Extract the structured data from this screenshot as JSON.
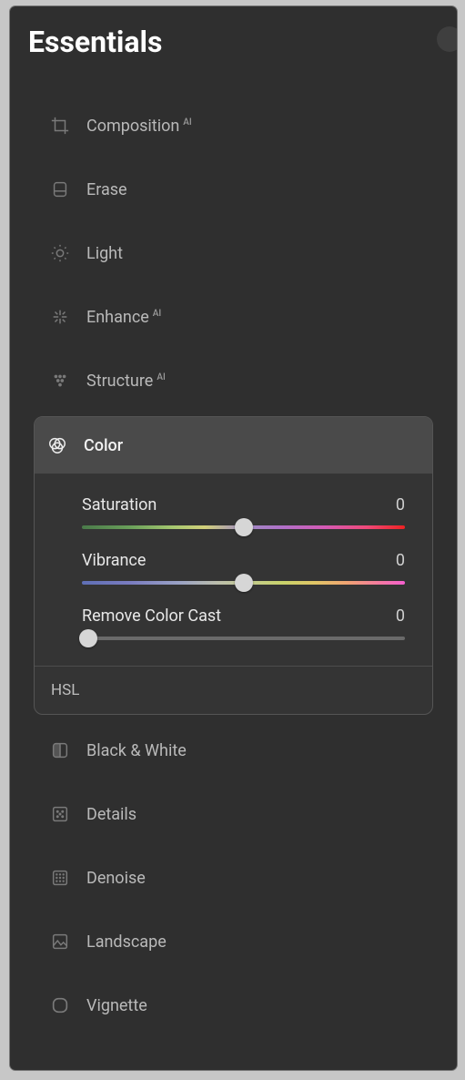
{
  "title": "Essentials",
  "ai_badge": "AI",
  "tools": {
    "composition": {
      "label": "Composition",
      "ai": true
    },
    "erase": {
      "label": "Erase",
      "ai": false
    },
    "light": {
      "label": "Light",
      "ai": false
    },
    "enhance": {
      "label": "Enhance",
      "ai": true
    },
    "structure": {
      "label": "Structure",
      "ai": true
    },
    "color": {
      "label": "Color",
      "ai": false
    },
    "bw": {
      "label": "Black & White",
      "ai": false
    },
    "details": {
      "label": "Details",
      "ai": false
    },
    "denoise": {
      "label": "Denoise",
      "ai": false
    },
    "landscape": {
      "label": "Landscape",
      "ai": false
    },
    "vignette": {
      "label": "Vignette",
      "ai": false
    }
  },
  "color_panel": {
    "sliders": {
      "saturation": {
        "name": "Saturation",
        "value": "0",
        "position": 50
      },
      "vibrance": {
        "name": "Vibrance",
        "value": "0",
        "position": 50
      },
      "removecast": {
        "name": "Remove Color Cast",
        "value": "0",
        "position": 2
      }
    },
    "footer": "HSL"
  }
}
